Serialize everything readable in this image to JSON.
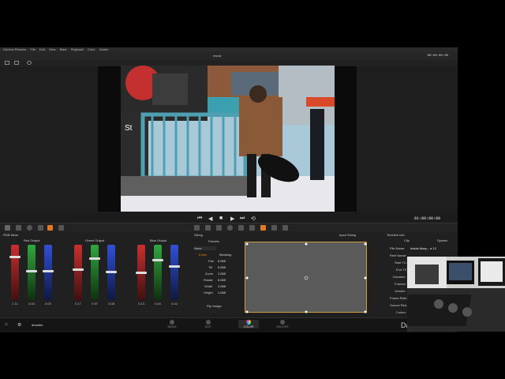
{
  "menu": [
    "DaVinci Resolve",
    "File",
    "Edit",
    "View",
    "Mark",
    "Playback",
    "Color",
    "Nodes"
  ],
  "title": {
    "project": "resolv",
    "timecode_top": "00:00:00:00"
  },
  "transport": {
    "timecode": "01:00:00:00",
    "buttons": [
      "⏮",
      "◀",
      "■",
      "▶",
      "⏭",
      "⟲"
    ]
  },
  "rgb_mixer": {
    "title": "RGB Mixer",
    "groups": [
      {
        "title": "Red Output",
        "values": [
          "1.11",
          "0.00",
          "0.00"
        ]
      },
      {
        "title": "Green Output",
        "values": [
          "0.17",
          "0.97",
          "0.08"
        ]
      },
      {
        "title": "Blue Output",
        "values": [
          "0.13",
          "0.00",
          "0.42"
        ]
      }
    ],
    "colors": {
      "red": "#c83030",
      "green": "#2fa83f",
      "blue": "#3050d8"
    }
  },
  "sizing": {
    "title": "Sizing",
    "presets_label": "Presets",
    "preset_value": "None",
    "tabs": [
      "Input Sizing"
    ],
    "modes": [
      "Editor",
      "Blanking"
    ],
    "params": [
      {
        "label": "Pan",
        "value": "0.000"
      },
      {
        "label": "Tilt",
        "value": "0.000"
      },
      {
        "label": "Zoom",
        "value": "1.000"
      },
      {
        "label": "Rotate",
        "value": "0.000"
      },
      {
        "label": "Width",
        "value": "1.000"
      },
      {
        "label": "Height",
        "value": "1.000"
      }
    ],
    "flip_label": "Flip Image"
  },
  "timeline_info": {
    "title": "Timeline Info",
    "col_clip": "Clip",
    "col_system": "System",
    "rows": [
      {
        "label": "File Name:",
        "value": "Inside-llewy... a 12"
      },
      {
        "label": "Reel Name:",
        "value": ""
      },
      {
        "label": "Start TC:",
        "value": ""
      },
      {
        "label": "End TC:",
        "value": ""
      },
      {
        "label": "Duration:",
        "value": ""
      },
      {
        "label": "Frames:",
        "value": ""
      },
      {
        "label": "Version:",
        "value": ""
      },
      {
        "label": "Frame Rate:",
        "value": ""
      },
      {
        "label": "Source Res:",
        "value": ""
      },
      {
        "label": "Codec:",
        "value": ""
      }
    ]
  },
  "bottom": {
    "project_name": "deauteb",
    "pages": [
      "MEDIA",
      "EDIT",
      "COLOR",
      "DELIVER"
    ],
    "active_page": "COLOR",
    "logo_text": "Da"
  }
}
